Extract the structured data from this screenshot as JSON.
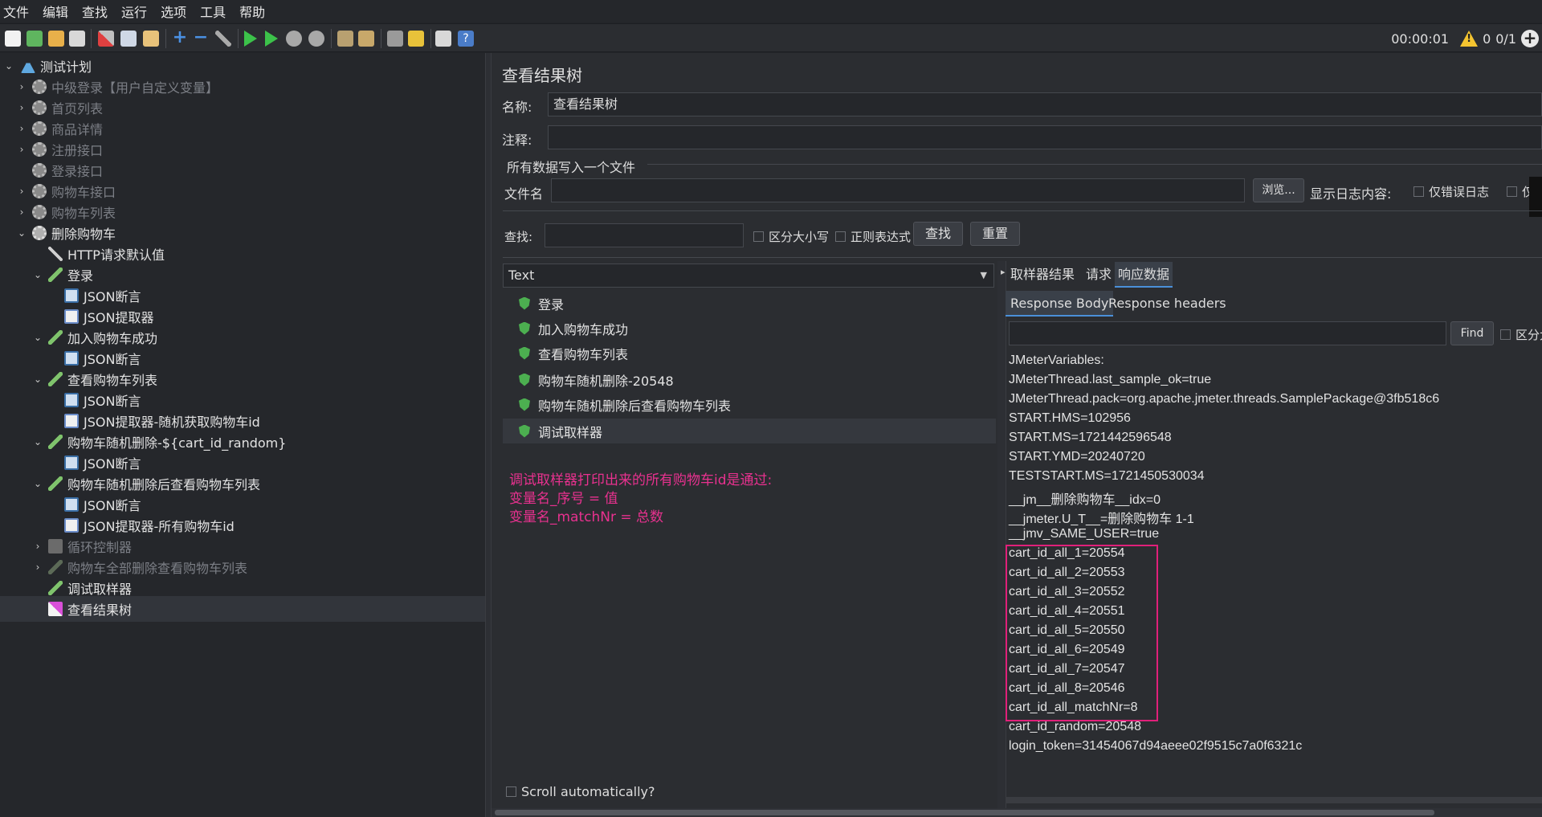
{
  "menu": [
    "文件",
    "编辑",
    "查找",
    "运行",
    "选项",
    "工具",
    "帮助"
  ],
  "toolbar": {
    "timer": "00:00:01",
    "warnings": "0",
    "threads": "0/1"
  },
  "tree": {
    "root": "测试计划",
    "items": [
      {
        "label": "中级登录【用户自定义变量】"
      },
      {
        "label": "首页列表"
      },
      {
        "label": "商品详情"
      },
      {
        "label": "注册接口"
      },
      {
        "label": "登录接口"
      },
      {
        "label": "购物车接口"
      },
      {
        "label": "购物车列表"
      },
      {
        "label": "删除购物车"
      },
      {
        "label": "HTTP请求默认值"
      },
      {
        "label": "登录"
      },
      {
        "label": "JSON断言"
      },
      {
        "label": "JSON提取器"
      },
      {
        "label": "加入购物车成功"
      },
      {
        "label": "JSON断言"
      },
      {
        "label": "查看购物车列表"
      },
      {
        "label": "JSON断言"
      },
      {
        "label": "JSON提取器-随机获取购物车id"
      },
      {
        "label": "购物车随机删除-${cart_id_random}"
      },
      {
        "label": "JSON断言"
      },
      {
        "label": "购物车随机删除后查看购物车列表"
      },
      {
        "label": "JSON断言"
      },
      {
        "label": "JSON提取器-所有购物车id"
      },
      {
        "label": "循环控制器"
      },
      {
        "label": "购物车全部删除查看购物车列表"
      },
      {
        "label": "调试取样器"
      },
      {
        "label": "查看结果树"
      }
    ]
  },
  "panel": {
    "title": "查看结果树",
    "name_label": "名称:",
    "name_value": "查看结果树",
    "comment_label": "注释:",
    "file_group": "所有数据写入一个文件",
    "file_label": "文件名",
    "browse": "浏览...",
    "log_label": "显示日志内容:",
    "errors_only": "仅错误日志",
    "success_partial": "仅"
  },
  "search": {
    "label": "查找:",
    "case": "区分大小写",
    "regex": "正则表达式",
    "find": "查找",
    "reset": "重置"
  },
  "renderer": "Text",
  "results": [
    "登录",
    "加入购物车成功",
    "查看购物车列表",
    "购物车随机删除-20548",
    "购物车随机删除后查看购物车列表",
    "调试取样器"
  ],
  "note": [
    "调试取样器打印出来的所有购物车id是通过:",
    "变量名_序号 = 值",
    "变量名_matchNr = 总数"
  ],
  "scroll_auto": "Scroll automatically?",
  "tabs": [
    "取样器结果",
    "请求",
    "响应数据"
  ],
  "subtabs": [
    "Response Body",
    "Response headers"
  ],
  "find_btn": "Find",
  "find_case": "区分大",
  "response": [
    "JMeterVariables:",
    "JMeterThread.last_sample_ok=true",
    "JMeterThread.pack=org.apache.jmeter.threads.SamplePackage@3fb518c6",
    "START.HMS=102956",
    "START.MS=1721442596548",
    "START.YMD=20240720",
    "TESTSTART.MS=1721450530034",
    "__jm__删除购物车__idx=0",
    "__jmeter.U_T__=删除购物车 1-1",
    "__jmv_SAME_USER=true",
    "cart_id_all_1=20554",
    "cart_id_all_2=20553",
    "cart_id_all_3=20552",
    "cart_id_all_4=20551",
    "cart_id_all_5=20550",
    "cart_id_all_6=20549",
    "cart_id_all_7=20547",
    "cart_id_all_8=20546",
    "cart_id_all_matchNr=8",
    "cart_id_random=20548",
    "login_token=31454067d94aeee02f9515c7a0f6321c"
  ],
  "colors": {
    "highlight": "#e0207a",
    "note": "#e8318f",
    "accent": "#4a90d9"
  }
}
